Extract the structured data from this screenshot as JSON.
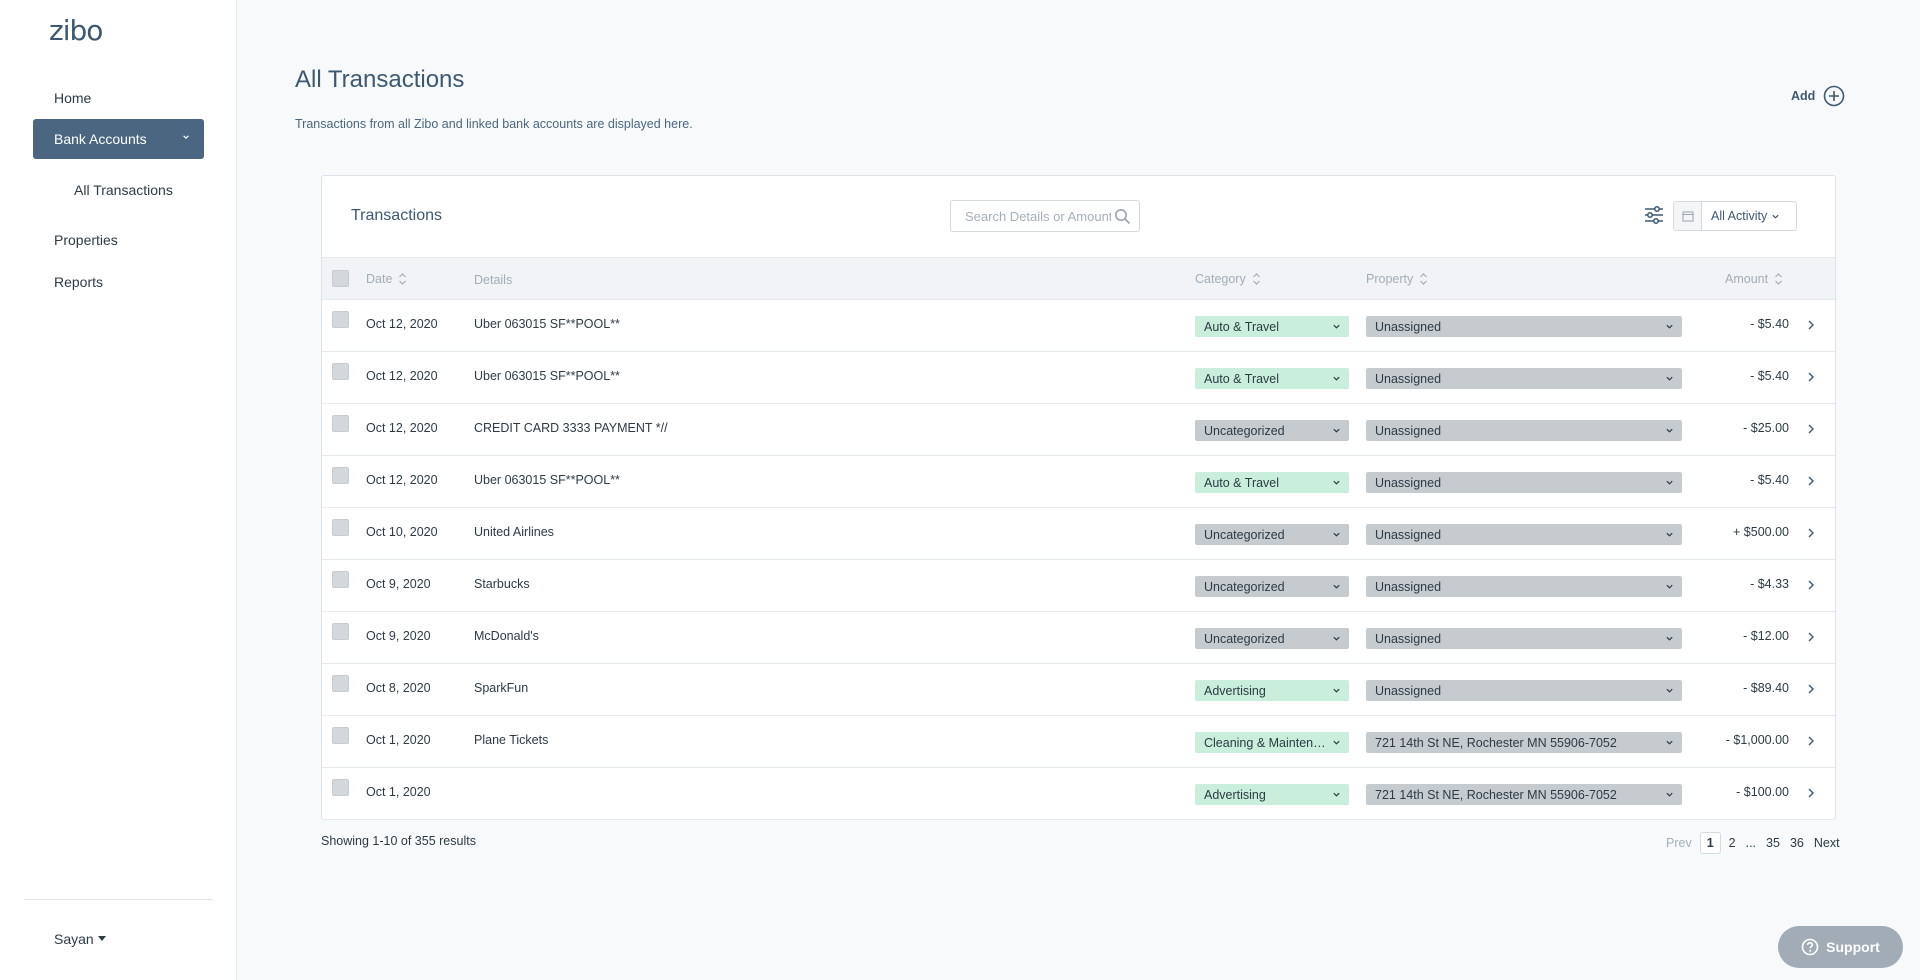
{
  "sidebar": {
    "logo": "zibo",
    "home": "Home",
    "bank_accounts": "Bank Accounts",
    "all_transactions": "All Transactions",
    "properties": "Properties",
    "reports": "Reports",
    "user": "Sayan"
  },
  "header": {
    "title": "All Transactions",
    "subtitle": "Transactions from all Zibo and linked bank accounts are displayed here.",
    "add_label": "Add"
  },
  "card": {
    "title": "Transactions",
    "search_placeholder": "Search Details or Amount",
    "activity_label": "All Activity"
  },
  "columns": {
    "date": "Date",
    "details": "Details",
    "category": "Category",
    "property": "Property",
    "amount": "Amount"
  },
  "rows": [
    {
      "date": "Oct 12, 2020",
      "details": "Uber 063015 SF**POOL**",
      "category": "Auto & Travel",
      "property": "Unassigned",
      "amount": "- $5.40"
    },
    {
      "date": "Oct 12, 2020",
      "details": "Uber 063015 SF**POOL**",
      "category": "Auto & Travel",
      "property": "Unassigned",
      "amount": "- $5.40"
    },
    {
      "date": "Oct 12, 2020",
      "details": "CREDIT CARD 3333 PAYMENT *//",
      "category": "Uncategorized",
      "property": "Unassigned",
      "amount": "- $25.00"
    },
    {
      "date": "Oct 12, 2020",
      "details": "Uber 063015 SF**POOL**",
      "category": "Auto & Travel",
      "property": "Unassigned",
      "amount": "- $5.40"
    },
    {
      "date": "Oct 10, 2020",
      "details": "United Airlines",
      "category": "Uncategorized",
      "property": "Unassigned",
      "amount": "+ $500.00"
    },
    {
      "date": "Oct 9, 2020",
      "details": "Starbucks",
      "category": "Uncategorized",
      "property": "Unassigned",
      "amount": "- $4.33"
    },
    {
      "date": "Oct 9, 2020",
      "details": "McDonald's",
      "category": "Uncategorized",
      "property": "Unassigned",
      "amount": "- $12.00"
    },
    {
      "date": "Oct 8, 2020",
      "details": "SparkFun",
      "category": "Advertising",
      "property": "Unassigned",
      "amount": "- $89.40"
    },
    {
      "date": "Oct 1, 2020",
      "details": "Plane Tickets",
      "category": "Cleaning & Maintenance",
      "property": "721 14th St NE, Rochester MN 55906-7052",
      "amount": "- $1,000.00"
    },
    {
      "date": "Oct 1, 2020",
      "details": "",
      "category": "Advertising",
      "property": "721 14th St NE, Rochester MN 55906-7052",
      "amount": "- $100.00"
    }
  ],
  "colors": {
    "categorized": "#c9eedb",
    "uncategorized": "#c6cbd0",
    "accent": "#4a6680"
  },
  "footer": {
    "results": "Showing 1-10 of 355 results",
    "prev": "Prev",
    "pages": [
      "1",
      "2",
      "...",
      "35",
      "36"
    ],
    "next": "Next"
  },
  "support": "Support"
}
